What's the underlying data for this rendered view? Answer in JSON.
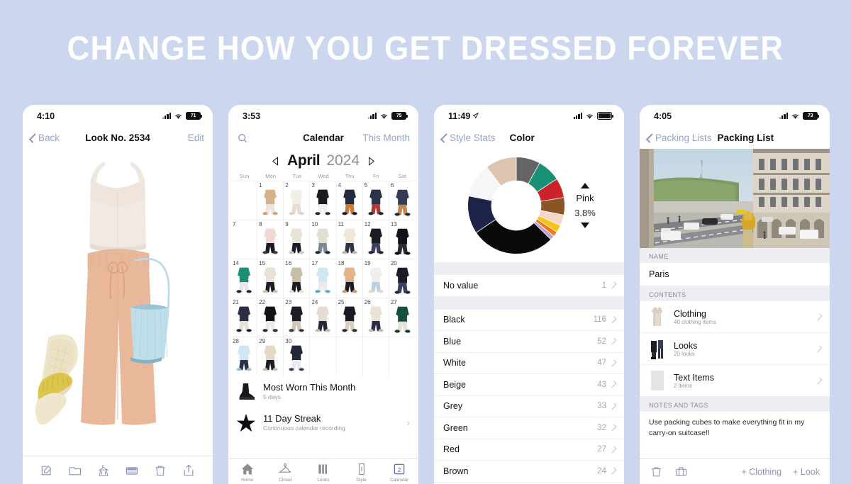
{
  "headline": "CHANGE HOW YOU GET DRESSED FOREVER",
  "theme": {
    "background": "#ccd7ef",
    "accent": "#8c96bd",
    "text": "#111111",
    "muted": "#9a9aa0"
  },
  "phone1": {
    "status": {
      "time": "4:10",
      "battery": "71"
    },
    "nav": {
      "back": "Back",
      "title": "Look No. 2534",
      "action": "Edit"
    },
    "look": {
      "description": "Cream crop tank top, peach wide-leg drawstring trousers, light blue pleated bucket bag, gold fringe slide sandals"
    },
    "toolbar": [
      {
        "name": "edit-icon",
        "label": "Edit"
      },
      {
        "name": "folder-icon",
        "label": "Folder"
      },
      {
        "name": "hanger-dress-icon",
        "label": "Clothing"
      },
      {
        "name": "list-icon",
        "label": "List"
      },
      {
        "name": "trash-icon",
        "label": "Delete"
      },
      {
        "name": "share-icon",
        "label": "Share"
      }
    ]
  },
  "phone2": {
    "status": {
      "time": "3:53",
      "battery": "75"
    },
    "nav": {
      "search": "search-icon",
      "title": "Calendar",
      "action": "This Month"
    },
    "calendar": {
      "month": "April",
      "year": "2024",
      "prev": "previous-month",
      "next": "next-month",
      "weekdays": [
        "Sun",
        "Mon",
        "Tue",
        "Wed",
        "Thu",
        "Fri",
        "Sat"
      ],
      "lead_blanks": 1,
      "days": [
        1,
        2,
        3,
        4,
        5,
        6,
        7,
        8,
        9,
        10,
        11,
        12,
        13,
        14,
        15,
        16,
        17,
        18,
        19,
        20,
        21,
        22,
        23,
        24,
        25,
        26,
        27,
        28,
        29,
        30
      ],
      "empty_days": [
        7
      ]
    },
    "stats": [
      {
        "icon": "boot-icon",
        "title": "Most Worn This Month",
        "subtitle": "5 days"
      },
      {
        "icon": "star-icon",
        "title": "11 Day Streak",
        "subtitle": "Continuous calendar recording"
      }
    ],
    "tabs": [
      {
        "icon": "home-icon",
        "label": "Home"
      },
      {
        "icon": "hanger-icon",
        "label": "Closet"
      },
      {
        "icon": "items-icon",
        "label": "Looks"
      },
      {
        "icon": "person-icon",
        "label": "Style"
      },
      {
        "icon": "calendar-icon",
        "label": "Calendar",
        "badge": "2"
      }
    ]
  },
  "phone3": {
    "status": {
      "time": "11:49",
      "location": true
    },
    "nav": {
      "back": "Style Stats",
      "title": "Color"
    },
    "selected": {
      "name": "Pink",
      "percent": "3.8%"
    },
    "no_value": {
      "label": "No value",
      "count": "1"
    },
    "chart_data": {
      "type": "pie",
      "title": "Color",
      "categories": [
        "Black",
        "Blue",
        "White",
        "Beige",
        "Grey",
        "Green",
        "Red",
        "Brown",
        "Pink",
        "Gold",
        "Orange",
        "Purple"
      ],
      "values": [
        116,
        52,
        47,
        43,
        33,
        32,
        27,
        24,
        15,
        10,
        7,
        6
      ],
      "colors": [
        "#0a0a0a",
        "#1d2448",
        "#f4f6f7",
        "#dec3ae",
        "#656565",
        "#189075",
        "#cc2229",
        "#8a5424",
        "#f4d6cb",
        "#f9c015",
        "#f07a16",
        "#b3a5cf"
      ],
      "legend": "list",
      "selected_slice": "Pink",
      "selected_percent": 3.8
    },
    "list": [
      {
        "label": "Black",
        "value": "116"
      },
      {
        "label": "Blue",
        "value": "52"
      },
      {
        "label": "White",
        "value": "47"
      },
      {
        "label": "Beige",
        "value": "43"
      },
      {
        "label": "Grey",
        "value": "33"
      },
      {
        "label": "Green",
        "value": "32"
      },
      {
        "label": "Red",
        "value": "27"
      },
      {
        "label": "Brown",
        "value": "24"
      }
    ]
  },
  "phone4": {
    "status": {
      "time": "4:05",
      "battery": "73"
    },
    "nav": {
      "back": "Packing Lists",
      "title": "Packing List"
    },
    "photo_alt": "Paris street view with Eiffel Tower and Haussmann building",
    "name_section": {
      "header": "NAME",
      "value": "Paris"
    },
    "contents_section": {
      "header": "CONTENTS",
      "items": [
        {
          "icon": "clothing-icon",
          "title": "Clothing",
          "subtitle": "40 clothing items"
        },
        {
          "icon": "looks-icon",
          "title": "Looks",
          "subtitle": "20 looks"
        },
        {
          "icon": "text-items-icon",
          "title": "Text Items",
          "subtitle": "2 items"
        }
      ]
    },
    "notes_section": {
      "header": "NOTES AND TAGS",
      "value": "Use packing cubes to make everything fit in my carry-on suitcase!!"
    },
    "toolbar": {
      "trash": "trash-icon",
      "suitcase": "suitcase-icon",
      "add_clothing": "+ Clothing",
      "add_look": "+ Look"
    }
  }
}
